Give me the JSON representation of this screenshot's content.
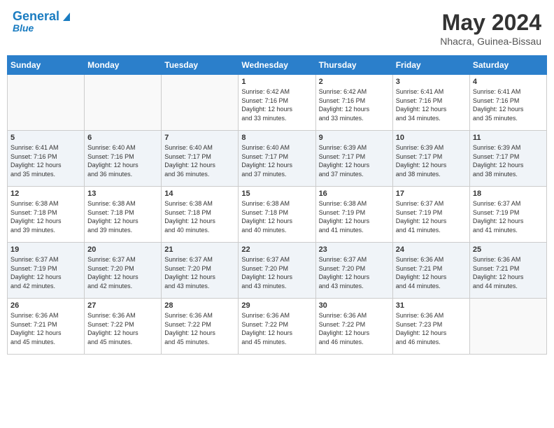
{
  "header": {
    "logo_general": "General",
    "logo_blue": "Blue",
    "month_title": "May 2024",
    "location": "Nhacra, Guinea-Bissau"
  },
  "days_of_week": [
    "Sunday",
    "Monday",
    "Tuesday",
    "Wednesday",
    "Thursday",
    "Friday",
    "Saturday"
  ],
  "weeks": [
    [
      {
        "day": "",
        "info": ""
      },
      {
        "day": "",
        "info": ""
      },
      {
        "day": "",
        "info": ""
      },
      {
        "day": "1",
        "info": "Sunrise: 6:42 AM\nSunset: 7:16 PM\nDaylight: 12 hours\nand 33 minutes."
      },
      {
        "day": "2",
        "info": "Sunrise: 6:42 AM\nSunset: 7:16 PM\nDaylight: 12 hours\nand 33 minutes."
      },
      {
        "day": "3",
        "info": "Sunrise: 6:41 AM\nSunset: 7:16 PM\nDaylight: 12 hours\nand 34 minutes."
      },
      {
        "day": "4",
        "info": "Sunrise: 6:41 AM\nSunset: 7:16 PM\nDaylight: 12 hours\nand 35 minutes."
      }
    ],
    [
      {
        "day": "5",
        "info": "Sunrise: 6:41 AM\nSunset: 7:16 PM\nDaylight: 12 hours\nand 35 minutes."
      },
      {
        "day": "6",
        "info": "Sunrise: 6:40 AM\nSunset: 7:16 PM\nDaylight: 12 hours\nand 36 minutes."
      },
      {
        "day": "7",
        "info": "Sunrise: 6:40 AM\nSunset: 7:17 PM\nDaylight: 12 hours\nand 36 minutes."
      },
      {
        "day": "8",
        "info": "Sunrise: 6:40 AM\nSunset: 7:17 PM\nDaylight: 12 hours\nand 37 minutes."
      },
      {
        "day": "9",
        "info": "Sunrise: 6:39 AM\nSunset: 7:17 PM\nDaylight: 12 hours\nand 37 minutes."
      },
      {
        "day": "10",
        "info": "Sunrise: 6:39 AM\nSunset: 7:17 PM\nDaylight: 12 hours\nand 38 minutes."
      },
      {
        "day": "11",
        "info": "Sunrise: 6:39 AM\nSunset: 7:17 PM\nDaylight: 12 hours\nand 38 minutes."
      }
    ],
    [
      {
        "day": "12",
        "info": "Sunrise: 6:38 AM\nSunset: 7:18 PM\nDaylight: 12 hours\nand 39 minutes."
      },
      {
        "day": "13",
        "info": "Sunrise: 6:38 AM\nSunset: 7:18 PM\nDaylight: 12 hours\nand 39 minutes."
      },
      {
        "day": "14",
        "info": "Sunrise: 6:38 AM\nSunset: 7:18 PM\nDaylight: 12 hours\nand 40 minutes."
      },
      {
        "day": "15",
        "info": "Sunrise: 6:38 AM\nSunset: 7:18 PM\nDaylight: 12 hours\nand 40 minutes."
      },
      {
        "day": "16",
        "info": "Sunrise: 6:38 AM\nSunset: 7:19 PM\nDaylight: 12 hours\nand 41 minutes."
      },
      {
        "day": "17",
        "info": "Sunrise: 6:37 AM\nSunset: 7:19 PM\nDaylight: 12 hours\nand 41 minutes."
      },
      {
        "day": "18",
        "info": "Sunrise: 6:37 AM\nSunset: 7:19 PM\nDaylight: 12 hours\nand 41 minutes."
      }
    ],
    [
      {
        "day": "19",
        "info": "Sunrise: 6:37 AM\nSunset: 7:19 PM\nDaylight: 12 hours\nand 42 minutes."
      },
      {
        "day": "20",
        "info": "Sunrise: 6:37 AM\nSunset: 7:20 PM\nDaylight: 12 hours\nand 42 minutes."
      },
      {
        "day": "21",
        "info": "Sunrise: 6:37 AM\nSunset: 7:20 PM\nDaylight: 12 hours\nand 43 minutes."
      },
      {
        "day": "22",
        "info": "Sunrise: 6:37 AM\nSunset: 7:20 PM\nDaylight: 12 hours\nand 43 minutes."
      },
      {
        "day": "23",
        "info": "Sunrise: 6:37 AM\nSunset: 7:20 PM\nDaylight: 12 hours\nand 43 minutes."
      },
      {
        "day": "24",
        "info": "Sunrise: 6:36 AM\nSunset: 7:21 PM\nDaylight: 12 hours\nand 44 minutes."
      },
      {
        "day": "25",
        "info": "Sunrise: 6:36 AM\nSunset: 7:21 PM\nDaylight: 12 hours\nand 44 minutes."
      }
    ],
    [
      {
        "day": "26",
        "info": "Sunrise: 6:36 AM\nSunset: 7:21 PM\nDaylight: 12 hours\nand 45 minutes."
      },
      {
        "day": "27",
        "info": "Sunrise: 6:36 AM\nSunset: 7:22 PM\nDaylight: 12 hours\nand 45 minutes."
      },
      {
        "day": "28",
        "info": "Sunrise: 6:36 AM\nSunset: 7:22 PM\nDaylight: 12 hours\nand 45 minutes."
      },
      {
        "day": "29",
        "info": "Sunrise: 6:36 AM\nSunset: 7:22 PM\nDaylight: 12 hours\nand 45 minutes."
      },
      {
        "day": "30",
        "info": "Sunrise: 6:36 AM\nSunset: 7:22 PM\nDaylight: 12 hours\nand 46 minutes."
      },
      {
        "day": "31",
        "info": "Sunrise: 6:36 AM\nSunset: 7:23 PM\nDaylight: 12 hours\nand 46 minutes."
      },
      {
        "day": "",
        "info": ""
      }
    ]
  ]
}
